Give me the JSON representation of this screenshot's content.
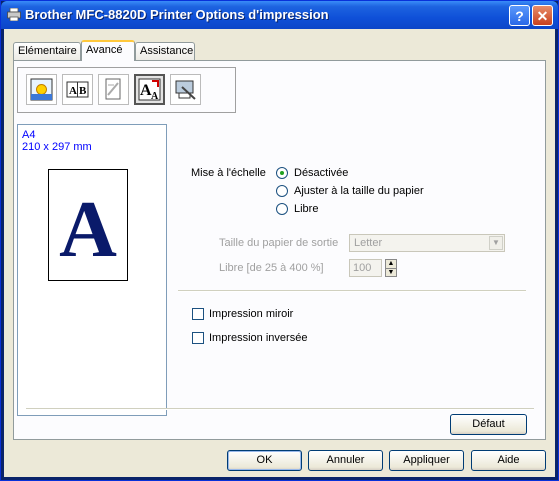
{
  "window": {
    "title": "Brother MFC-8820D Printer Options d'impression",
    "help_label": "?",
    "close_label": "✕",
    "icon": "printer-icon"
  },
  "tabs": [
    {
      "label": "Elémentaire",
      "active": false
    },
    {
      "label": "Avancé",
      "active": true
    },
    {
      "label": "Assistance",
      "active": false
    }
  ],
  "toolbar": {
    "icons": [
      "color-quality-icon",
      "duplex-icon",
      "copy-watermark-icon",
      "scaling-icon",
      "device-options-icon"
    ],
    "selected_index": 3
  },
  "preview": {
    "paper_name": "A4",
    "paper_dimensions": "210 x 297 mm",
    "letter": "A"
  },
  "scaling": {
    "label": "Mise à l'échelle",
    "options": [
      {
        "label": "Désactivée",
        "checked": true
      },
      {
        "label": "Ajuster à la taille du papier",
        "checked": false
      },
      {
        "label": "Libre",
        "checked": false
      }
    ],
    "output_size_label": "Taille du papier de sortie",
    "output_size_value": "Letter",
    "free_label": "Libre [de 25 à 400 %]",
    "free_value": "100"
  },
  "options": {
    "mirror_label": "Impression miroir",
    "mirror_checked": false,
    "reverse_label": "Impression inversée",
    "reverse_checked": false
  },
  "buttons": {
    "default_label": "Défaut",
    "ok_label": "OK",
    "cancel_label": "Annuler",
    "apply_label": "Appliquer",
    "help_label": "Aide"
  },
  "colors": {
    "title_bar": "#0f50d8",
    "paper_size_text": "#0000ff",
    "disabled_text": "#a0a0a0"
  }
}
